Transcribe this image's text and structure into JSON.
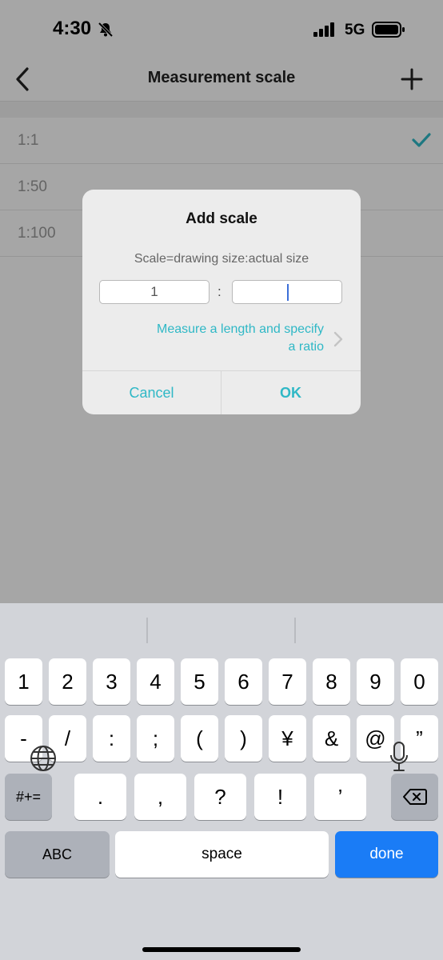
{
  "status_bar": {
    "time": "4:30",
    "network": "5G"
  },
  "nav": {
    "title": "Measurement scale"
  },
  "scale_list": [
    {
      "label": "1:1",
      "selected": true
    },
    {
      "label": "1:50",
      "selected": false
    },
    {
      "label": "1:100",
      "selected": false
    }
  ],
  "dialog": {
    "title": "Add scale",
    "subtitle": "Scale=drawing size:actual size",
    "drawing_value": "1",
    "separator": ":",
    "actual_value": "",
    "measure_link_line1": "Measure a length and specify",
    "measure_link_line2": "a ratio",
    "cancel_label": "Cancel",
    "ok_label": "OK"
  },
  "keyboard": {
    "row1": [
      "1",
      "2",
      "3",
      "4",
      "5",
      "6",
      "7",
      "8",
      "9",
      "0"
    ],
    "row2": [
      "-",
      "/",
      ":",
      ";",
      "(",
      ")",
      "¥",
      "&",
      "@",
      "”"
    ],
    "symbols_toggle": "#+=",
    "row3": [
      ".",
      ",",
      "?",
      "!",
      "’"
    ],
    "abc": "ABC",
    "space": "space",
    "done": "done"
  },
  "colors": {
    "accent": "#2fb8c6",
    "done_key": "#1a7cf6"
  }
}
